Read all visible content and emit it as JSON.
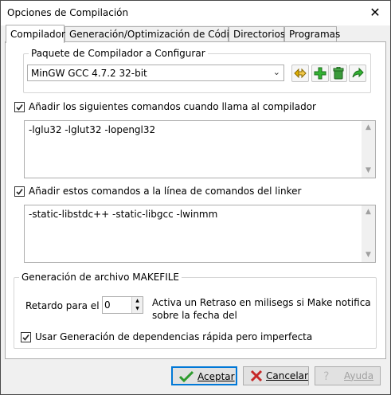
{
  "window": {
    "title": "Opciones de Compilación",
    "close_glyph": "✕"
  },
  "tabs": [
    {
      "label": "Compilador",
      "active": true
    },
    {
      "label": "Generación/Optimización de Código",
      "active": false
    },
    {
      "label": "Directorios",
      "active": false
    },
    {
      "label": "Programas",
      "active": false
    }
  ],
  "compiler_set": {
    "group_label": "Paquete de Compilador a Configurar",
    "selected": "MinGW GCC 4.7.2 32-bit",
    "dropdown_glyph": "⌄",
    "tool_icons": [
      "rename-icon",
      "add-icon",
      "delete-icon",
      "import-icon"
    ]
  },
  "compiler_cmds": {
    "checkbox_label": "Añadir los siguientes comandos cuando llama al compilador",
    "checked": true,
    "value": "-lglu32 -lglut32 -lopengl32"
  },
  "linker_cmds": {
    "checkbox_label": "Añadir estos comandos a la línea de comandos del linker",
    "checked": true,
    "value": "-static-libstdc++ -static-libgcc -lwinmm"
  },
  "makefile": {
    "group_label": "Generación de archivo MAKEFILE",
    "delay_label": "Retardo para el Co",
    "delay_value": "0",
    "delay_desc": "Activa un Retraso en milisegs si Make notifica sobre la fecha del",
    "fast_deps_label": "Usar Generación de dependencias rápida pero imperfecta",
    "fast_deps_checked": true
  },
  "buttons": {
    "ok": "Aceptar",
    "cancel": "Cancelar",
    "help": "Ayuda"
  },
  "colors": {
    "accent": "#0078d7",
    "ok_check": "#2e9b2e",
    "cancel_x": "#c62828"
  }
}
